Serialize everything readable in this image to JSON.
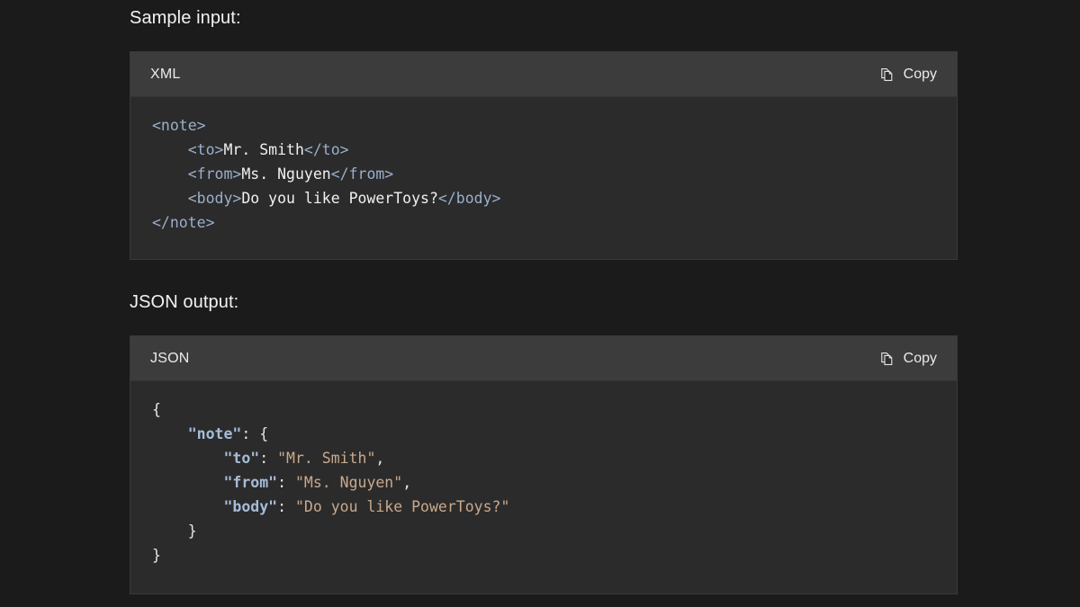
{
  "theme": {
    "page_background": "#1b1b1b",
    "card_background": "#2b2b2b",
    "header_background": "#3c3c3c",
    "text_primary": "#f2f2f2",
    "syntax_tag": "#9aafcb",
    "syntax_key": "#a5bcd8",
    "syntax_string": "#c9a98d",
    "syntax_plain": "#e6e6e6"
  },
  "sections": {
    "input": {
      "label": "Sample input:",
      "card": {
        "language": "XML",
        "copy_label": "Copy",
        "copy_icon": "copy-pages-icon",
        "lines": [
          [
            {
              "t": "<note>",
              "c": "tag"
            }
          ],
          [
            {
              "t": "    ",
              "c": "punc"
            },
            {
              "t": "<to>",
              "c": "tag"
            },
            {
              "t": "Mr. Smith",
              "c": "txt"
            },
            {
              "t": "</to>",
              "c": "tag"
            }
          ],
          [
            {
              "t": "    ",
              "c": "punc"
            },
            {
              "t": "<from>",
              "c": "tag"
            },
            {
              "t": "Ms. Nguyen",
              "c": "txt"
            },
            {
              "t": "</from>",
              "c": "tag"
            }
          ],
          [
            {
              "t": "    ",
              "c": "punc"
            },
            {
              "t": "<body>",
              "c": "tag"
            },
            {
              "t": "Do you like PowerToys?",
              "c": "txt"
            },
            {
              "t": "</body>",
              "c": "tag"
            }
          ],
          [
            {
              "t": "</note>",
              "c": "tag"
            }
          ]
        ],
        "plain_text": "<note>\n    <to>Mr. Smith</to>\n    <from>Ms. Nguyen</from>\n    <body>Do you like PowerToys?</body>\n</note>"
      }
    },
    "output": {
      "label": "JSON output:",
      "card": {
        "language": "JSON",
        "copy_label": "Copy",
        "copy_icon": "copy-pages-icon",
        "lines": [
          [
            {
              "t": "{",
              "c": "punc"
            }
          ],
          [
            {
              "t": "    ",
              "c": "punc"
            },
            {
              "t": "\"note\"",
              "c": "key"
            },
            {
              "t": ": {",
              "c": "punc"
            }
          ],
          [
            {
              "t": "        ",
              "c": "punc"
            },
            {
              "t": "\"to\"",
              "c": "key"
            },
            {
              "t": ": ",
              "c": "punc"
            },
            {
              "t": "\"Mr. Smith\"",
              "c": "str"
            },
            {
              "t": ",",
              "c": "punc"
            }
          ],
          [
            {
              "t": "        ",
              "c": "punc"
            },
            {
              "t": "\"from\"",
              "c": "key"
            },
            {
              "t": ": ",
              "c": "punc"
            },
            {
              "t": "\"Ms. Nguyen\"",
              "c": "str"
            },
            {
              "t": ",",
              "c": "punc"
            }
          ],
          [
            {
              "t": "        ",
              "c": "punc"
            },
            {
              "t": "\"body\"",
              "c": "key"
            },
            {
              "t": ": ",
              "c": "punc"
            },
            {
              "t": "\"Do you like PowerToys?\"",
              "c": "str"
            }
          ],
          [
            {
              "t": "    }",
              "c": "punc"
            }
          ],
          [
            {
              "t": "}",
              "c": "punc"
            }
          ]
        ],
        "plain_text": "{\n    \"note\": {\n        \"to\": \"Mr. Smith\",\n        \"from\": \"Ms. Nguyen\",\n        \"body\": \"Do you like PowerToys?\"\n    }\n}"
      }
    }
  }
}
